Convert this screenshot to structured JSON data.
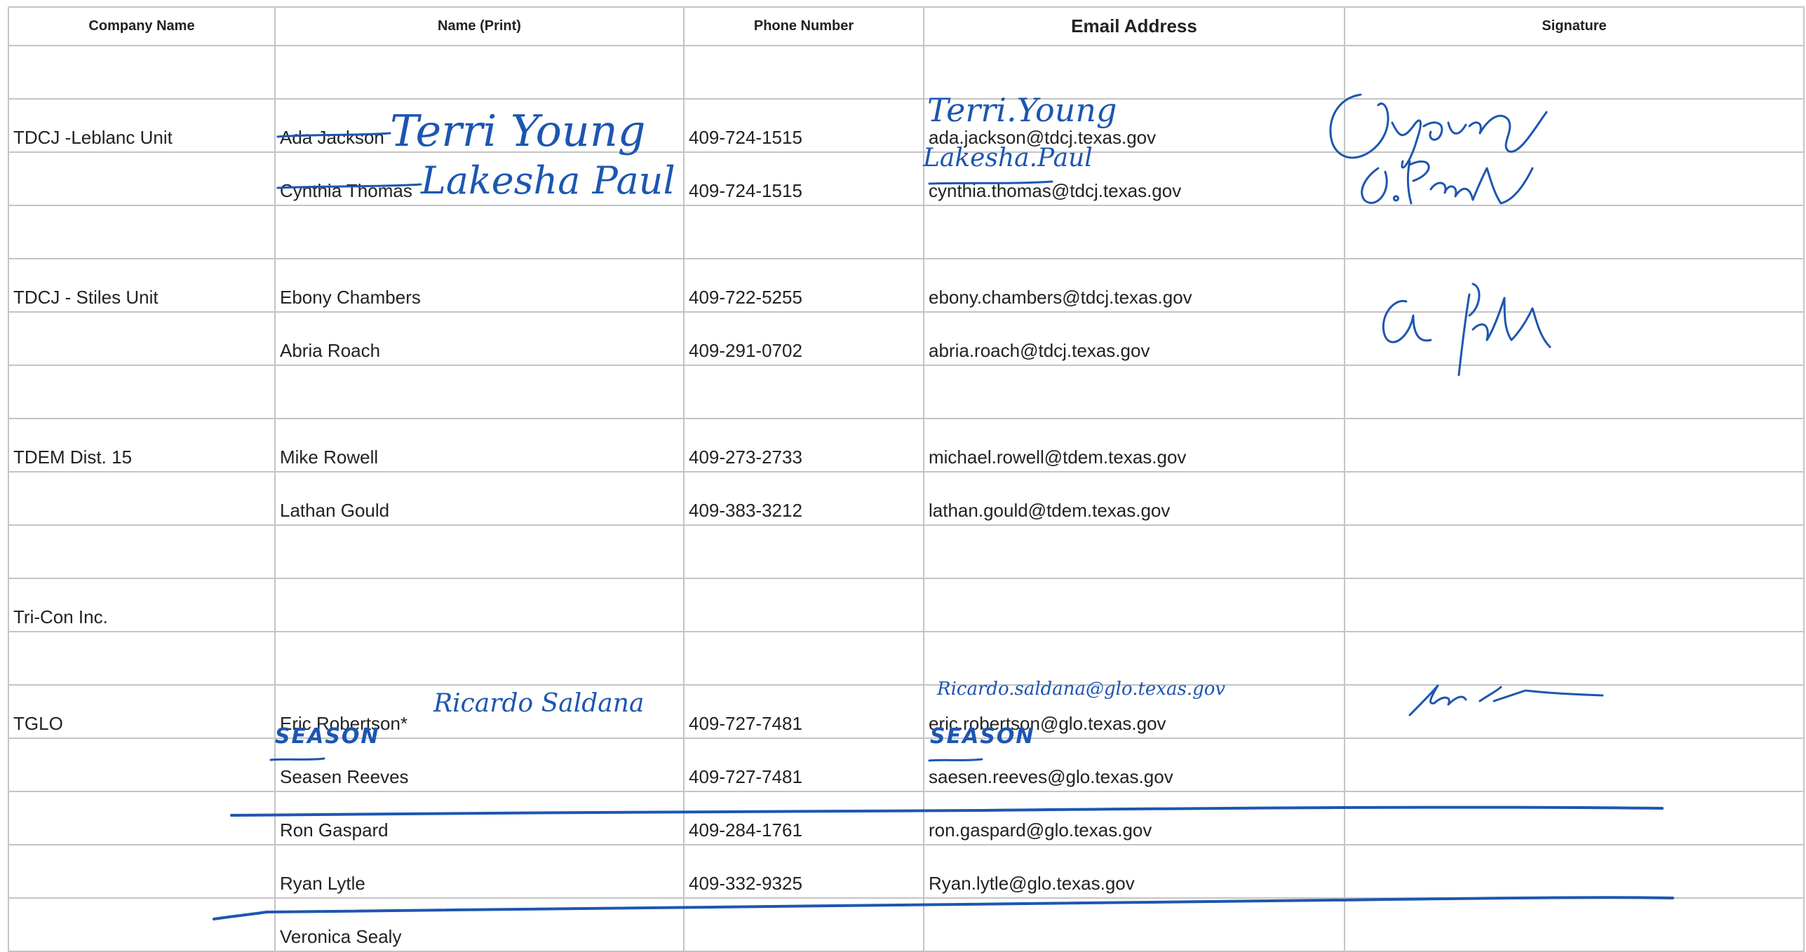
{
  "headers": {
    "company": "Company Name",
    "name": "Name (Print)",
    "phone": "Phone Number",
    "email": "Email Address",
    "signature": "Signature"
  },
  "rows": [
    {
      "company": "",
      "name": "",
      "phone": "",
      "email": ""
    },
    {
      "company": "TDCJ -Leblanc Unit",
      "name": "Ada Jackson",
      "phone": "409-724-1515",
      "email": "ada.jackson@tdcj.texas.gov"
    },
    {
      "company": "",
      "name": "Cynthia Thomas",
      "phone": "409-724-1515",
      "email": "cynthia.thomas@tdcj.texas.gov"
    },
    {
      "company": "",
      "name": "",
      "phone": "",
      "email": ""
    },
    {
      "company": "TDCJ - Stiles Unit",
      "name": "Ebony Chambers",
      "phone": "409-722-5255",
      "email": "ebony.chambers@tdcj.texas.gov"
    },
    {
      "company": "",
      "name": "Abria Roach",
      "phone": "409-291-0702",
      "email": "abria.roach@tdcj.texas.gov"
    },
    {
      "company": "",
      "name": "",
      "phone": "",
      "email": ""
    },
    {
      "company": "TDEM Dist. 15",
      "name": "Mike Rowell",
      "phone": "409-273-2733",
      "email": "michael.rowell@tdem.texas.gov"
    },
    {
      "company": "",
      "name": "Lathan Gould",
      "phone": "409-383-3212",
      "email": "lathan.gould@tdem.texas.gov"
    },
    {
      "company": "",
      "name": "",
      "phone": "",
      "email": ""
    },
    {
      "company": "Tri-Con Inc.",
      "name": "",
      "phone": "",
      "email": ""
    },
    {
      "company": "",
      "name": "",
      "phone": "",
      "email": ""
    },
    {
      "company": "TGLO",
      "name": "Eric Robertson*",
      "phone": "409-727-7481",
      "email": "eric.robertson@glo.texas.gov"
    },
    {
      "company": "",
      "name": "Seasen Reeves",
      "phone": "409-727-7481",
      "email": "saesen.reeves@glo.texas.gov"
    },
    {
      "company": "",
      "name": "Ron Gaspard",
      "phone": "409-284-1761",
      "email": "ron.gaspard@glo.texas.gov"
    },
    {
      "company": "",
      "name": "Ryan Lytle",
      "phone": "409-332-9325",
      "email": "Ryan.lytle@glo.texas.gov"
    },
    {
      "company": "",
      "name": "Veronica Sealy",
      "phone": "",
      "email": ""
    }
  ],
  "handwriting": {
    "terri_name": "Terri Young",
    "lakesha_name": "Lakesha Paul",
    "terri_email": "Terri.Young",
    "lakesha_email": "Lakesha.Paul",
    "ricardo_name": "Ricardo Saldana",
    "ricardo_email": "Ricardo.saldana@glo.texas.gov",
    "season_name": "SEASON",
    "season_email": "SEASON"
  },
  "colors": {
    "ink": "#1d56b0",
    "grid": "#c4c4c4",
    "text": "#222222"
  }
}
